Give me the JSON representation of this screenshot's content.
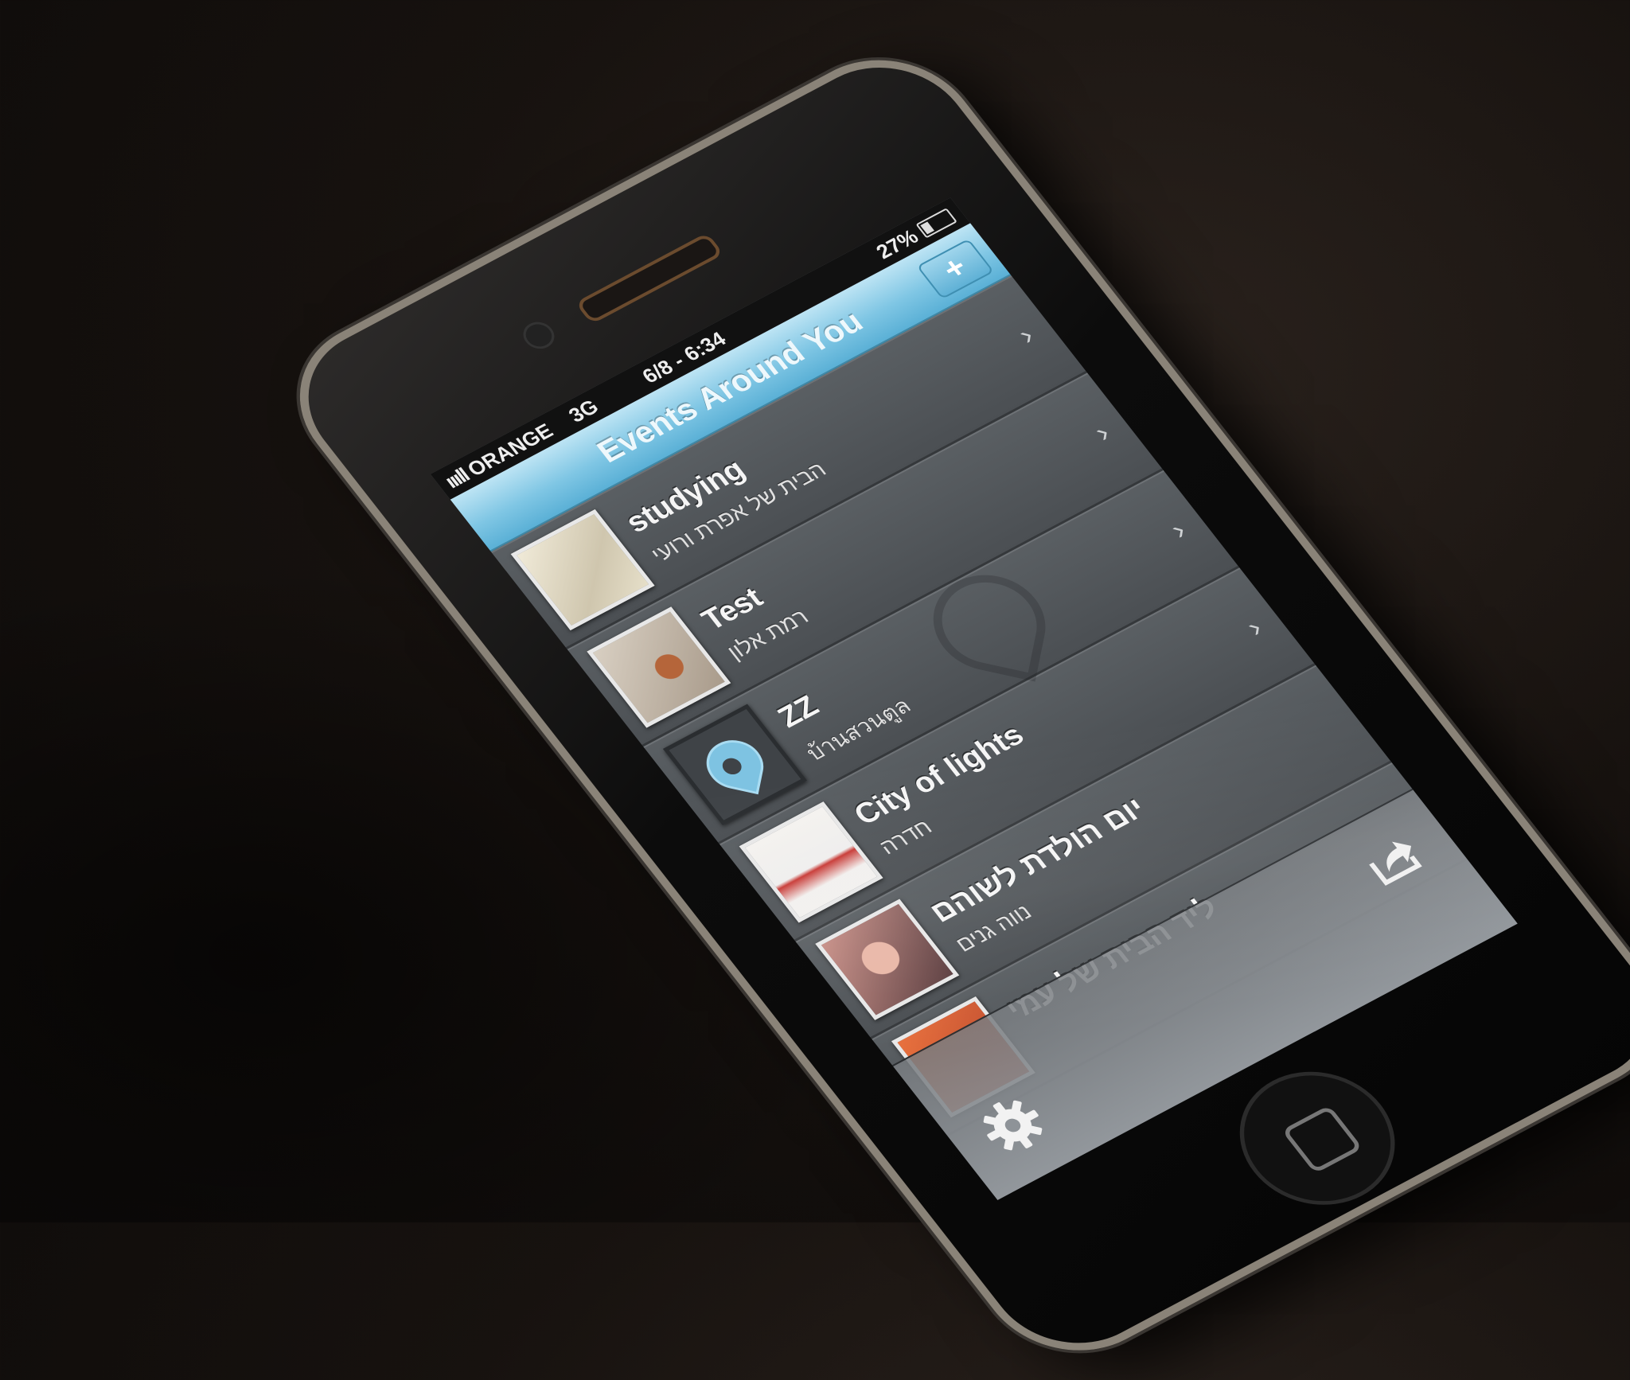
{
  "status_bar": {
    "signal": "ıııll",
    "carrier": "ORANGE",
    "network": "3G",
    "time": "6/8 - 6:34",
    "battery_percent": "27%",
    "battery_level": 0.27
  },
  "nav": {
    "title": "Events Around You",
    "add_label": "+"
  },
  "events": [
    {
      "title": "studying",
      "location": "הבית של אפרת ורועי",
      "thumb": "t-cloth"
    },
    {
      "title": "Test",
      "location": "רמת אלון",
      "thumb": "t-cat"
    },
    {
      "title": "ZZ",
      "location": "บ้านสวนตูล",
      "thumb": "t-logo"
    },
    {
      "title": "City of lights",
      "location": "חדרה",
      "thumb": "t-lights"
    },
    {
      "title": "יום הולדת לשוהם",
      "location": "נווה גנים",
      "thumb": "t-baby"
    },
    {
      "title": "ליד הבית של עמי",
      "location": "",
      "thumb": "t-orange"
    }
  ],
  "chevron": "›",
  "icons": {
    "settings": "gear-icon",
    "share": "share-icon",
    "chevron": "chevron-right-icon",
    "add": "plus-icon"
  },
  "colors": {
    "nav_top": "#bde4f4",
    "nav_bottom": "#5ab0d6",
    "row_bg": "#50555a"
  }
}
